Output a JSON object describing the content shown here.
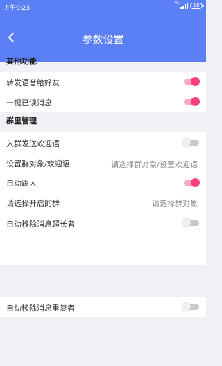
{
  "status_bar": {
    "time": "上午9:23",
    "network": "4G",
    "battery": "18"
  },
  "header": {
    "title": "参数设置",
    "background": "#5b80f6"
  },
  "sections": {
    "other": {
      "title": "其他功能"
    },
    "group": {
      "title": "群里管理"
    }
  },
  "rows": {
    "forward_voice": {
      "label": "转发语音给好友",
      "enabled": true
    },
    "read_all": {
      "label": "一键已读消息",
      "enabled": true
    },
    "join_welcome": {
      "label": "入群发送欢迎语",
      "enabled": false
    },
    "welcome_target": {
      "label": "设置群对象/欢迎语",
      "placeholder": "请选择群对象/设置欢迎语",
      "value": ""
    },
    "auto_kick": {
      "label": "自动踢人",
      "enabled": true
    },
    "select_group": {
      "label": "请选择开启的群",
      "placeholder": "请选择群对象",
      "value": ""
    },
    "remove_long": {
      "label": "自动移除消息超长者",
      "enabled": false
    },
    "remove_dup": {
      "label": "自动移除消息重复者",
      "enabled": false
    }
  },
  "colors": {
    "toggle_on": "#ff3f7f",
    "toggle_on_track": "#f7a8c0",
    "toggle_off_track": "#c8c8c8"
  },
  "icons": {
    "back": "back-arrow-icon",
    "signal": "signal-icon",
    "battery": "battery-icon"
  }
}
